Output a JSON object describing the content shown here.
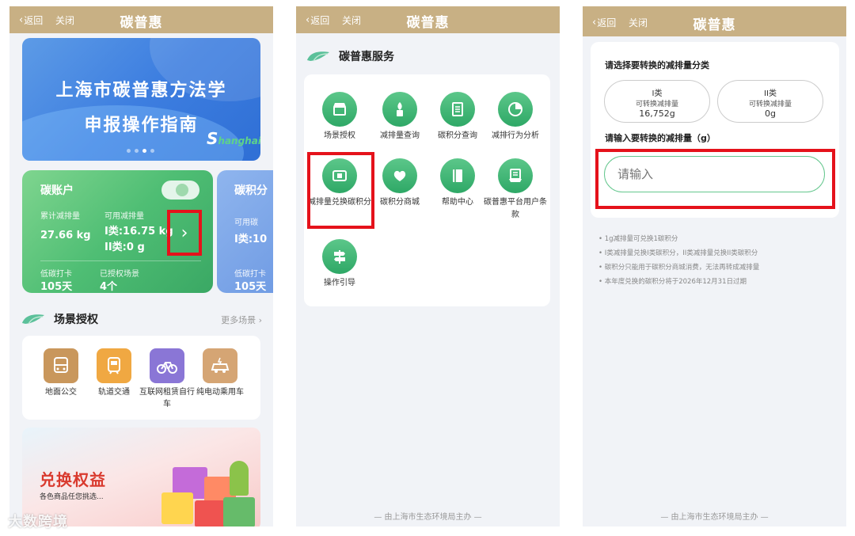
{
  "topbar": {
    "back": "返回",
    "close": "关闭",
    "title": "碳普惠"
  },
  "screen1": {
    "banner": {
      "line1": "上海市碳普惠方法学",
      "line2": "申报操作指南",
      "logo_s": "S",
      "logo_rest": "hanghai"
    },
    "account_card": {
      "title": "碳账户",
      "cumulative_label": "累计减排量",
      "cumulative_value": "27.66 kg",
      "available_label": "可用减排量",
      "class1": "I类:16.75 kg",
      "class2": "II类:0 g",
      "checkin_label": "低碳打卡",
      "checkin_value": "105天",
      "scenes_label": "已授权场景",
      "scenes_value": "4个"
    },
    "points_card": {
      "title": "碳积分",
      "available_label": "可用碳",
      "class1": "I类:10",
      "checkin_label": "低碳打卡",
      "checkin_value": "105天"
    },
    "scene_section": {
      "title": "场景授权",
      "more": "更多场景"
    },
    "scenes": [
      {
        "label": "地面公交",
        "color": "#c9975c"
      },
      {
        "label": "轨道交通",
        "color": "#f0a842"
      },
      {
        "label": "互联网租赁自行车",
        "color": "#8a76d6"
      },
      {
        "label": "纯电动乘用车",
        "color": "#d5a574"
      }
    ],
    "promo": {
      "title": "兑换权益",
      "subtitle": "各色商品任您挑选..."
    },
    "watermark": "大数跨境"
  },
  "screen2": {
    "section_title": "碳普惠服务",
    "services": [
      {
        "label": "场景授权"
      },
      {
        "label": "减排量查询"
      },
      {
        "label": "碳积分查询"
      },
      {
        "label": "减排行为分析"
      },
      {
        "label": "减排量兑换碳积分"
      },
      {
        "label": "碳积分商城"
      },
      {
        "label": "帮助中心"
      },
      {
        "label": "碳普惠平台用户条款"
      },
      {
        "label": "操作引导"
      }
    ],
    "footer": "— 由上海市生态环境局主办 —"
  },
  "screen3": {
    "select_title": "请选择要转换的减排量分类",
    "options": [
      {
        "name": "I类",
        "desc": "可转换减排量",
        "value": "16,752g"
      },
      {
        "name": "II类",
        "desc": "可转换减排量",
        "value": "0g"
      }
    ],
    "input_title": "请输入要转换的减排量（g）",
    "input_placeholder": "请输入",
    "notes": [
      "• 1g减排量可兑换1碳积分",
      "• I类减排量兑换I类碳积分，II类减排量兑换II类碳积分",
      "• 碳积分只能用于碳积分商城消费，无法再转成减排量",
      "• 本年度兑换的碳积分将于2026年12月31日过期"
    ],
    "footer": "— 由上海市生态环境局主办 —"
  },
  "colors": {
    "topbar": "#c8b084",
    "green": "#3aa864",
    "highlight": "#e5121b"
  }
}
